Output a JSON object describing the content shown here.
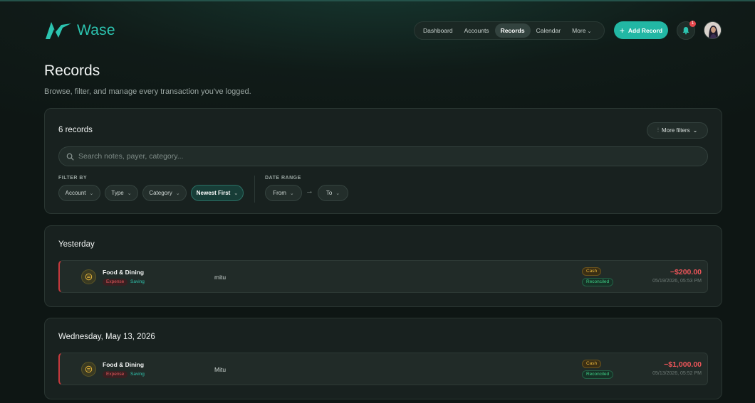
{
  "app": {
    "name": "Wase",
    "accent": "#22b7a4"
  },
  "nav": {
    "items": [
      {
        "label": "Dashboard",
        "active": false
      },
      {
        "label": "Accounts",
        "active": false
      },
      {
        "label": "Records",
        "active": true
      },
      {
        "label": "Calendar",
        "active": false
      },
      {
        "label": "More",
        "active": false
      }
    ]
  },
  "header": {
    "add_record_label": "Add Record",
    "notification_count": "1",
    "icons": [
      "plus-icon",
      "bell-icon",
      "avatar"
    ]
  },
  "page": {
    "title": "Records",
    "subtitle": "Browse, filter, and manage every transaction you've logged."
  },
  "filters": {
    "count_label": "6 records",
    "more_filters_label": "More filters",
    "search_placeholder": "Search notes, payer, category...",
    "filter_by_label": "FILTER BY",
    "chips": {
      "account": "Account",
      "type": "Type",
      "category": "Category",
      "sort": "Newest First"
    },
    "date_range_label": "DATE RANGE",
    "from_label": "From",
    "to_label": "To",
    "arrow": "→"
  },
  "groups": [
    {
      "title": "Yesterday",
      "records": [
        {
          "category": "Food & Dining",
          "type_tag": "Expense",
          "sub_tag": "Saving",
          "payer": "mitu",
          "account_tag": "Cash",
          "status_tag": "Reconciled",
          "amount": "−$200.00",
          "timestamp": "05/19/2026, 05:53 PM"
        }
      ]
    },
    {
      "title": "Wednesday, May 13, 2026",
      "records": [
        {
          "category": "Food & Dining",
          "type_tag": "Expense",
          "sub_tag": "Saving",
          "payer": "Mitu",
          "account_tag": "Cash",
          "status_tag": "Reconciled",
          "amount": "−$1,000.00",
          "timestamp": "05/13/2026, 05:52 PM"
        }
      ]
    }
  ]
}
